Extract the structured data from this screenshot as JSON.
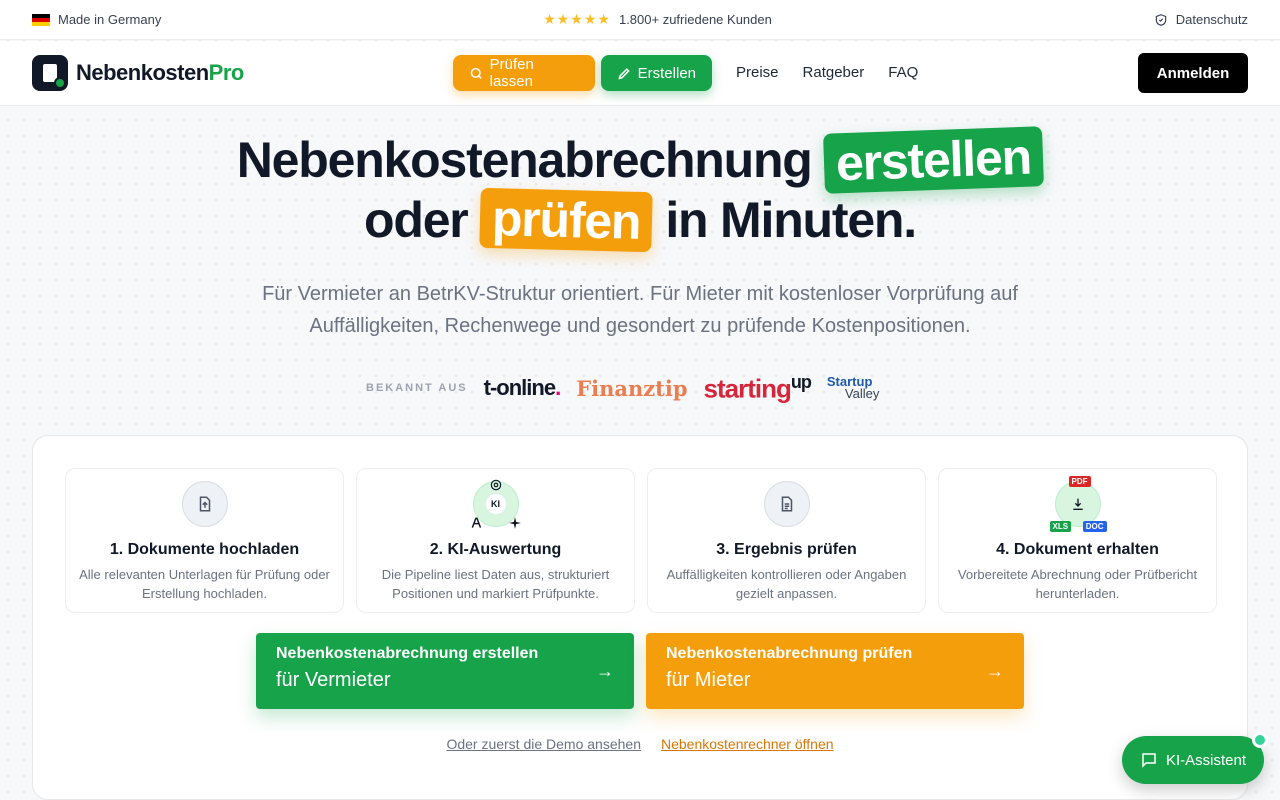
{
  "topbar": {
    "made_in": "Made in Germany",
    "rating_stars": "★★★★★",
    "customers": "1.800+ zufriedene Kunden",
    "privacy": "Datenschutz"
  },
  "nav": {
    "logo_main": "Nebenkosten",
    "logo_pro": "Pro",
    "pruefen_button": "Prüfen lassen",
    "erstellen_button": "Erstellen",
    "links": [
      "Preise",
      "Ratgeber",
      "FAQ"
    ],
    "login": "Anmelden"
  },
  "hero": {
    "line1": "Nebenkostenabrechnung",
    "highlight1": "erstellen",
    "line2_prefix": "oder",
    "highlight2": "prüfen",
    "line2_suffix": "in Minuten.",
    "subtitle": "Für Vermieter an BetrKV-Struktur orientiert. Für Mieter mit kostenloser Vorprüfung auf Auffälligkeiten, Rechenwege und gesondert zu prüfende Kostenpositionen."
  },
  "press": {
    "label": "BEKANNT AUS",
    "tonline": "t-online",
    "tonline_dot": ".",
    "finanztip": "Finanztip",
    "starting": "starting",
    "starting_up": "up",
    "startup": "Startup",
    "valley": "Valley"
  },
  "steps": [
    {
      "title": "1. Dokumente hochladen",
      "desc": "Alle relevanten Unterlagen für Prüfung oder Erstellung hochladen.",
      "icon": "upload-file-icon"
    },
    {
      "title": "2. KI-Auswertung",
      "desc": "Die Pipeline liest Daten aus, strukturiert Positionen und markiert Prüfpunkte.",
      "icon": "ki-icon",
      "badge": "KI"
    },
    {
      "title": "3. Ergebnis prüfen",
      "desc": "Auffälligkeiten kontrollieren oder Angaben gezielt anpassen.",
      "icon": "document-icon"
    },
    {
      "title": "4. Dokument erhalten",
      "desc": "Vorbereitete Abrechnung oder Prüfbericht herunterladen.",
      "icon": "download-icon",
      "formats": [
        "PDF",
        "XLS",
        "DOC"
      ]
    }
  ],
  "cta": {
    "create_title": "Nebenkostenabrechnung erstellen",
    "create_sub": "für Vermieter",
    "check_title": "Nebenkostenabrechnung prüfen",
    "check_sub": "für Mieter",
    "arrow": "→"
  },
  "links": {
    "demo": "Oder zuerst die Demo ansehen",
    "rechner": "Nebenkostenrechner öffnen"
  },
  "assistant": {
    "label": "KI-Assistent"
  },
  "colors": {
    "green": "#16a34a",
    "orange": "#f59e0b",
    "dark": "#111827"
  }
}
